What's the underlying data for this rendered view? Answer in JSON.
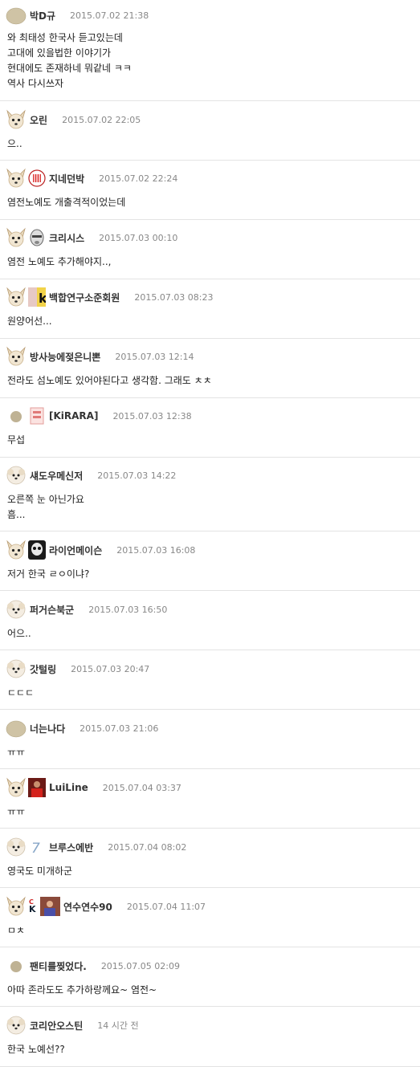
{
  "comments": [
    {
      "user": "박D규",
      "date": "2015.07.02 21:38",
      "text": "와 최태성 한국사 듣고있는데\n고대에 있을법한 이야기가\n 현대에도 존재하네 뭐같네 ㅋㅋ\n역사 다시쓰자",
      "avatar": "round-beige",
      "badge": null
    },
    {
      "user": "오린",
      "date": "2015.07.02 22:05",
      "text": "으..",
      "avatar": "chihuahua",
      "badge": null
    },
    {
      "user": "지네던박",
      "date": "2015.07.02 22:24",
      "text": "염전노예도 개출격적이었는데",
      "avatar": "chihuahua",
      "badge": "club-crest"
    },
    {
      "user": "크리시스",
      "date": "2015.07.03 00:10",
      "text": "염전 노예도 추가해야지..,",
      "avatar": "chihuahua",
      "badge": "mask"
    },
    {
      "user": "백합연구소준회원",
      "date": "2015.07.03 08:23",
      "text": "원양어선...",
      "avatar": "chihuahua",
      "badge": "anime-k"
    },
    {
      "user": "방사능에젖은니뽄",
      "date": "2015.07.03 12:14",
      "text": "전라도 섬노예도 있어야된다고 생각함. 그래도 ㅊㅊ",
      "avatar": "chihuahua",
      "badge": null
    },
    {
      "user": "[KiRARA]",
      "date": "2015.07.03 12:38",
      "text": "무섭",
      "avatar": "small-round",
      "badge": "pink-figure"
    },
    {
      "user": "섀도우메신저",
      "date": "2015.07.03 14:22",
      "text": "오른쪽 눈 아닌가요\n흠...",
      "avatar": "poodle",
      "badge": null
    },
    {
      "user": "라이언메이슨",
      "date": "2015.07.03 16:08",
      "text": "저거 한국 ㄹㅇ이냐?",
      "avatar": "chihuahua",
      "badge": "skull"
    },
    {
      "user": "퍼거슨북군",
      "date": "2015.07.03 16:50",
      "text": "어으..",
      "avatar": "poodle",
      "badge": null
    },
    {
      "user": "갓털링",
      "date": "2015.07.03 20:47",
      "text": "ㄷㄷㄷ",
      "avatar": "poodle",
      "badge": null
    },
    {
      "user": "너는나다",
      "date": "2015.07.03 21:06",
      "text": "ㅠㅠ",
      "avatar": "round-beige",
      "badge": null
    },
    {
      "user": "LuiLine",
      "date": "2015.07.04 03:37",
      "text": "ㅠㅠ",
      "avatar": "chihuahua",
      "badge": "red-player"
    },
    {
      "user": "브루스에반",
      "date": "2015.07.04 08:02",
      "text": "영국도 미개하군",
      "avatar": "poodle",
      "badge": "number-7"
    },
    {
      "user": "연수연수90",
      "date": "2015.07.04 11:07",
      "text": "ㅁㅊ",
      "avatar": "chihuahua",
      "badge": "ck-pair"
    },
    {
      "user": "팬티를찢었다.",
      "date": "2015.07.05 02:09",
      "text": "아따 존라도도 추가하랑께요~ 염전~",
      "avatar": "small-round",
      "badge": null
    },
    {
      "user": "코리안오스틴",
      "date": "14 시간 전",
      "text": "한국 노예선??",
      "avatar": "poodle",
      "badge": null
    }
  ]
}
